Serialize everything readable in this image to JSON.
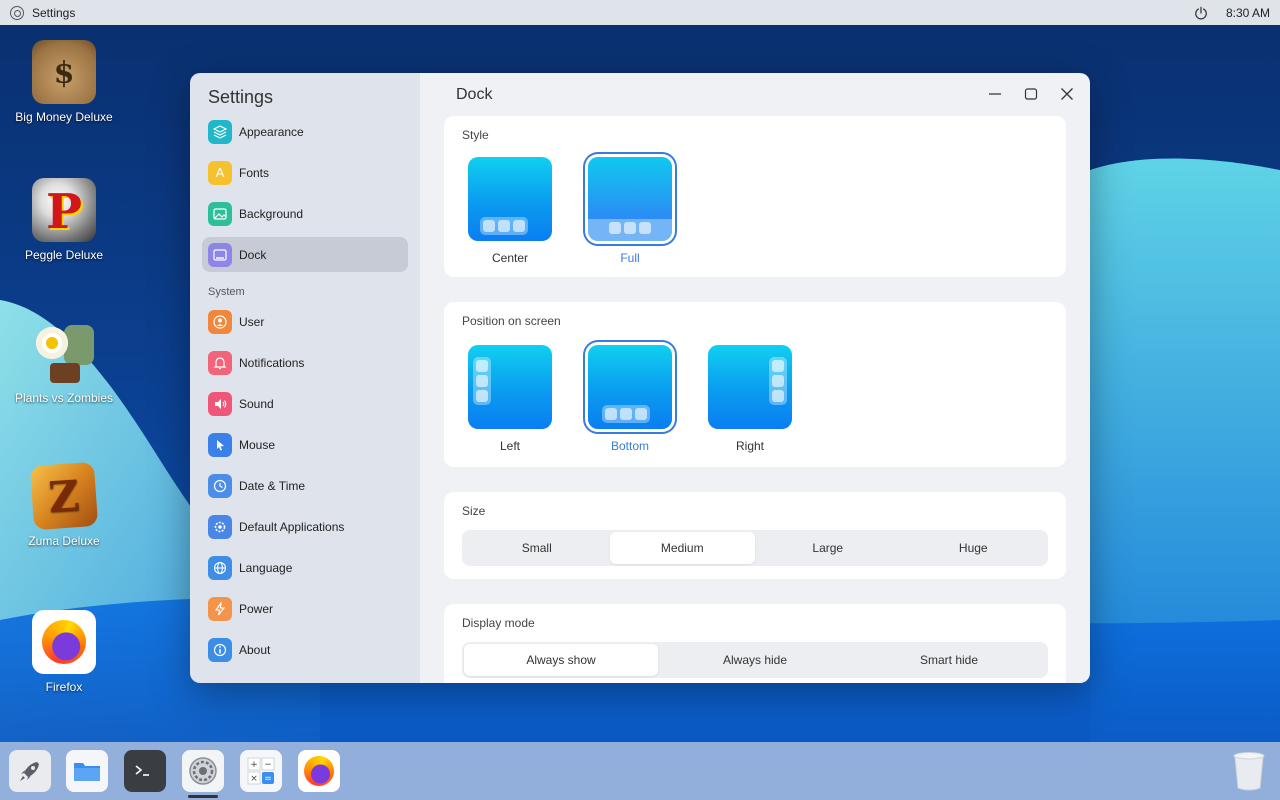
{
  "topbar": {
    "app_name": "Settings",
    "time": "8:30 AM",
    "icons": {
      "app": "settings-gear-icon",
      "power": "power-icon"
    }
  },
  "desktop": {
    "icons": [
      {
        "label": "Big Money Deluxe",
        "icon": "money-bag-icon"
      },
      {
        "label": "Peggle Deluxe",
        "icon": "peggle-icon"
      },
      {
        "label": "Plants vs Zombies",
        "icon": "plants-vs-zombies-icon"
      },
      {
        "label": "Zuma Deluxe",
        "icon": "zuma-icon"
      },
      {
        "label": "Firefox",
        "icon": "firefox-icon"
      }
    ]
  },
  "settings": {
    "title": "Settings",
    "nav": {
      "appearance": "Appearance",
      "fonts": "Fonts",
      "background": "Background",
      "dock": "Dock",
      "system_label": "System",
      "user": "User",
      "notifications": "Notifications",
      "sound": "Sound",
      "mouse": "Mouse",
      "date_time": "Date & Time",
      "default_apps": "Default Applications",
      "language": "Language",
      "power": "Power",
      "about": "About"
    },
    "active_nav": "Dock"
  },
  "dock_page": {
    "title": "Dock",
    "style": {
      "label": "Style",
      "center": "Center",
      "full": "Full",
      "selected": "Full"
    },
    "position": {
      "label": "Position on screen",
      "left": "Left",
      "bottom": "Bottom",
      "right": "Right",
      "selected": "Bottom"
    },
    "size": {
      "label": "Size",
      "small": "Small",
      "medium": "Medium",
      "large": "Large",
      "huge": "Huge",
      "selected": "Medium"
    },
    "display_mode": {
      "label": "Display mode",
      "always_show": "Always show",
      "always_hide": "Always hide",
      "smart_hide": "Smart hide",
      "selected": "Always show"
    }
  },
  "taskbar": {
    "apps": [
      "launcher-rocket-icon",
      "files-folder-icon",
      "terminal-icon",
      "settings-gear-icon",
      "calculator-icon",
      "firefox-icon"
    ],
    "trash": "trash-icon"
  },
  "colors": {
    "accent": "#3a7be0",
    "sidebar": "#dfe3ec",
    "main": "#eff1f4"
  }
}
